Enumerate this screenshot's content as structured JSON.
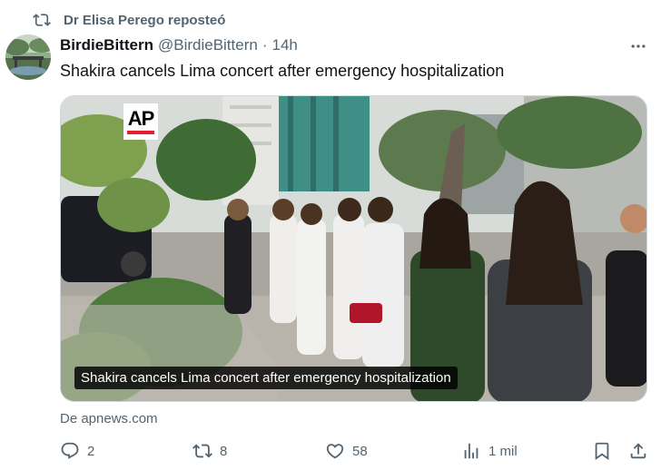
{
  "repost": {
    "icon": "repost-icon",
    "text": "Dr Elisa Perego reposteó"
  },
  "author": {
    "display_name": "BirdieBittern",
    "handle": "@BirdieBittern",
    "separator": "·",
    "timestamp": "14h"
  },
  "tweet": {
    "text": "Shakira cancels Lima concert after emergency hospitalization"
  },
  "media": {
    "logo": "AP",
    "caption": "Shakira cancels Lima concert after emergency hospitalization"
  },
  "source": {
    "text": "De apnews.com"
  },
  "actions": {
    "reply_count": "2",
    "repost_count": "8",
    "like_count": "58",
    "views_count": "1 mil"
  },
  "colors": {
    "text_primary": "#0f1419",
    "text_secondary": "#536471",
    "ap_red": "#e4202e"
  }
}
